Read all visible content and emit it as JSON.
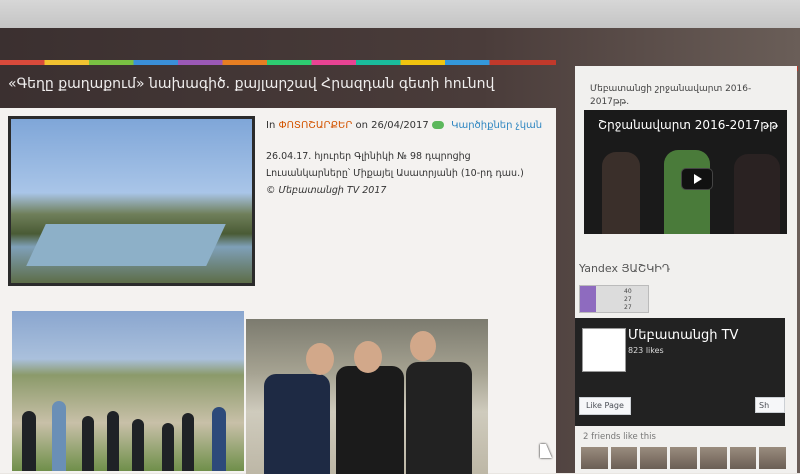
{
  "post": {
    "title": "«Գեղը քաղաքում» նախագիծ. քայլարշավ Հրազդան գետի հունով",
    "meta_in": "In",
    "category": "ՓՈՏՈՇԱՐՔԵՐ",
    "meta_on": "on",
    "date": "26/04/2017",
    "comments": "Կարծիքներ չկան",
    "line1": "26.04.17. հյուրեր Գլինիկի № 98 դպրոցից",
    "line2": "Լուսանկարները՝ Միքայել Ասատրյանի (10-րդ դաս.)",
    "copyright": "© Մեբատանցի TV 2017"
  },
  "sidebar": {
    "widget_title": "Մեբատանցի շրջանավարտ 2016-2017թթ.",
    "video_title": "Շրջանավարտ 2016-2017թթ",
    "yandex_label": "Yandex ՅԱՇԿԻԴ",
    "yandex_counter": {
      "v1": "40",
      "v2": "27",
      "v3": "27"
    },
    "fb_page_name": "Մեբատանցի TV",
    "fb_likes": "823 likes",
    "fb_like_button": "Like Page",
    "fb_share_button": "Sh",
    "friends_text": "2 friends like this"
  },
  "colors": {
    "accent_orange": "#d35400",
    "link_blue": "#2e86c1",
    "comment_green": "#5cb85c",
    "header_bg": "#3b3030"
  }
}
